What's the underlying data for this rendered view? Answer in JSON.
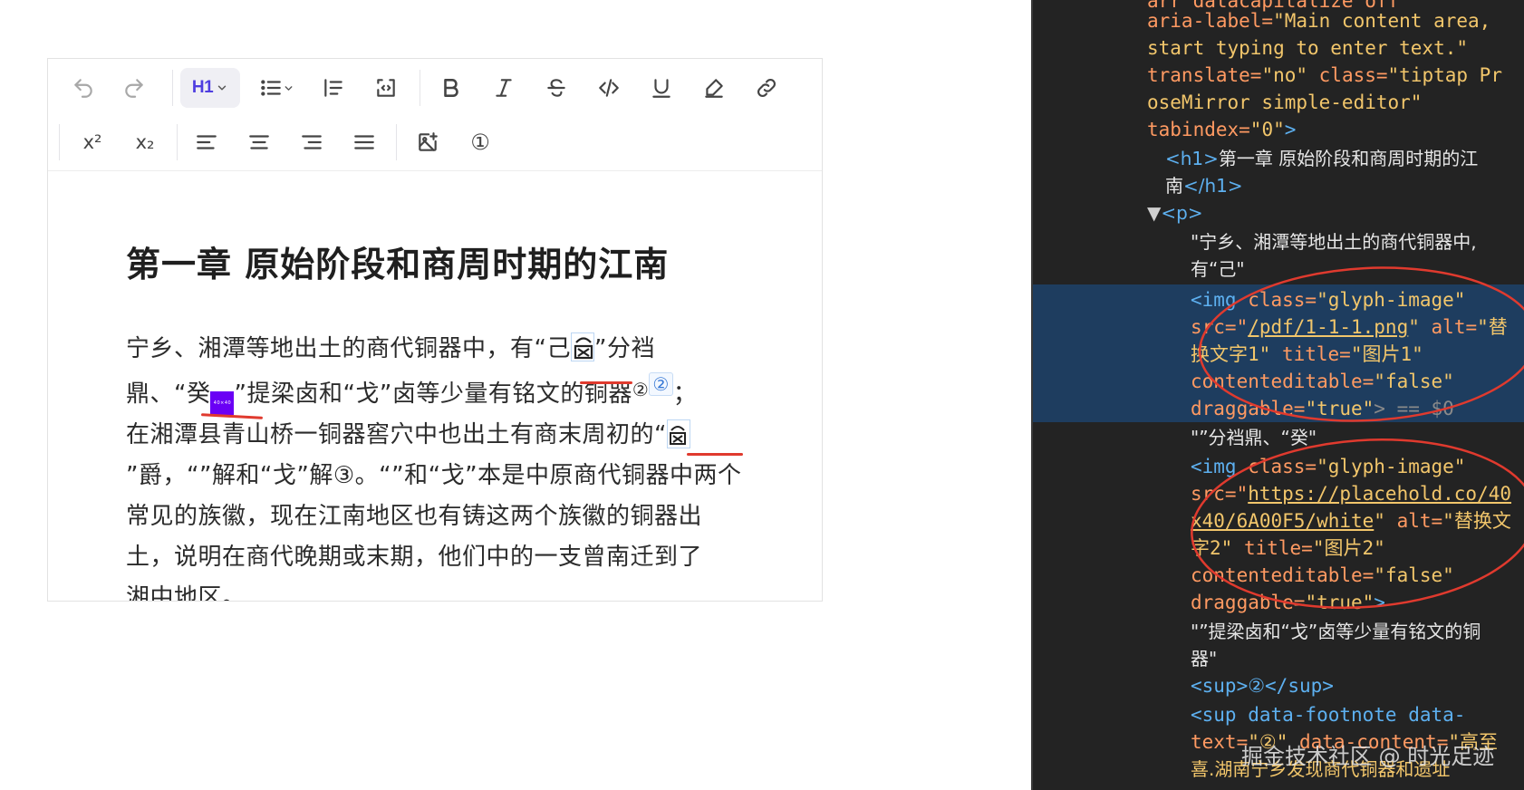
{
  "toolbar": {
    "heading_label": "H1",
    "superscript_label": "x²",
    "subscript_label": "x₂",
    "footnote_label": "①"
  },
  "editor": {
    "title": "第一章 原始阶段和商周时期的江南",
    "body": {
      "l1a": "宁乡、湘潭等地出土的商代铜器中，有“己",
      "l1b": "”分裆",
      "l2a": "鼎、“癸",
      "l2b": "”提梁卤和“戈”卤等少量有铭文的铜器",
      "l2_sup": "②",
      "l2_fn": "②",
      "l2c": "；",
      "l3": "在湘潭县青山桥一铜器窖穴中也出土有商末周初的“",
      "l4": "”爵，“”解和“戈”解③。“”和“戈”本是中原商代铜器中两个",
      "l5": "常见的族徽，现在江南地区也有铸这两个族徽的铜器出",
      "l6": "土，说明在商代晚期或末期，他们中的一支曾南迁到了",
      "l7": "湘中地区。"
    },
    "glyph2_text": "40×40"
  },
  "devtools": {
    "l0": "arr  datacapitalize off",
    "l1a": "aria-label=",
    "l1b": "\"Main content area,",
    "l2": "start typing to enter text.\"",
    "l3a": "translate=",
    "l3b": "\"no\"",
    "l3c": " class=",
    "l3d": "\"tiptap Pr",
    "l4": "oseMirror simple-editor\"",
    "l5a": "tabindex=",
    "l5b": "\"0\"",
    "l5c": ">",
    "h1_open": "<h1>",
    "h1_text": "第一章 原始阶段和商周时期的江",
    "h1_text2": "南",
    "h1_close": "</h1>",
    "p_open": "<p>",
    "t1": "\"宁乡、湘潭等地出土的商代铜器中,",
    "t2": "有“己\"",
    "img1_a": "<img",
    "img1_b": " class=",
    "img1_c": "\"glyph-image\"",
    "img1_src_a": "src=\"",
    "img1_src_b": "/pdf/1-1-1.png",
    "img1_src_c": "\"",
    "img1_alt_a": " alt=",
    "img1_alt_b": "\"替",
    "img1_l3": "换文字1\"",
    "img1_title_a": " title=",
    "img1_title_b": "\"图片1\"",
    "img1_ce_a": "contenteditable=",
    "img1_ce_b": "\"false\"",
    "img1_dr_a": "draggable=",
    "img1_dr_b": "\"true\"",
    "img1_dr_c": "> == $0",
    "t3": "\"”分裆鼎、“癸\"",
    "img2_a": "<img",
    "img2_b": " class=",
    "img2_c": "\"glyph-image\"",
    "img2_src_a": "src=\"",
    "img2_src_b": "https://placehold.co/40",
    "img2_src_l2": "x40/6A00F5/white",
    "img2_src_c": "\"",
    "img2_alt_a": " alt=",
    "img2_alt_b": "\"替换文",
    "img2_l3a": "字2\"",
    "img2_title_a": " title=",
    "img2_title_b": "\"图片2\"",
    "img2_ce_a": "contenteditable=",
    "img2_ce_b": "\"false\"",
    "img2_dr_a": "draggable=",
    "img2_dr_b": "\"true\"",
    "img2_dr_c": ">",
    "t4": "\"”提梁卤和“戈”卤等少量有铭文的铜",
    "t5": "器\"",
    "sup1": "<sup>②</sup>",
    "sup2_a": "<sup data-footnote data-",
    "sup2_b": "text=",
    "sup2_c": "\"②\"",
    "sup2_d": " data-content=",
    "sup2_e": "\"高至",
    "sup2_l2": "喜.湖南宁乡发现商代铜器和遗址"
  },
  "watermark": "掘金技术社区 @ 时光足迹",
  "colors": {
    "accent": "#4f3ee0",
    "devtools_bg": "#232323",
    "selection": "#1e3d5f",
    "attr": "#ff9a62",
    "value": "#f2c66b",
    "tag": "#5db0f0",
    "annotation": "#e03a2e"
  }
}
